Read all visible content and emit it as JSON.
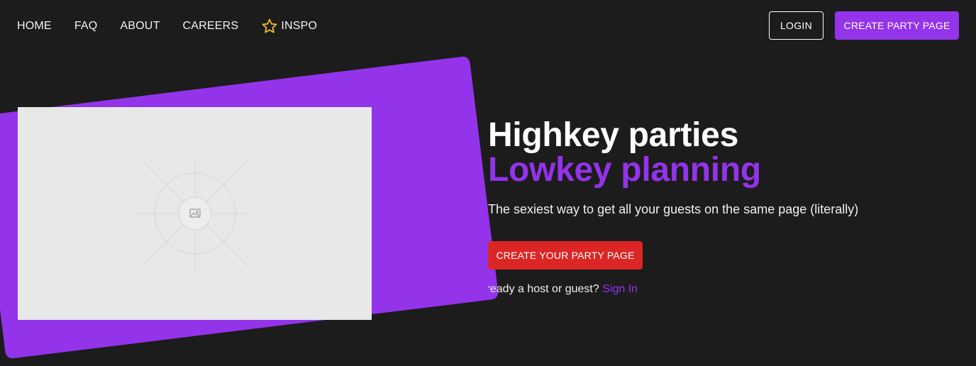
{
  "nav": {
    "links": [
      {
        "label": "HOME"
      },
      {
        "label": "FAQ"
      },
      {
        "label": "ABOUT"
      },
      {
        "label": "CAREERS"
      },
      {
        "label": "INSPO",
        "icon": "star-icon"
      }
    ],
    "login_label": "LOGIN",
    "create_label": "CREATE PARTY PAGE"
  },
  "hero": {
    "title_line1": "Highkey parties",
    "title_line2": "Lowkey planning",
    "subtitle": "The sexiest way to get all your guests on the same page (literally)",
    "cta_label": "CREATE YOUR PARTY PAGE",
    "signin_prompt": "lready a host or guest?",
    "signin_link": "Sign In",
    "image_icon": "image-placeholder-icon"
  },
  "colors": {
    "background": "#1c1c1c",
    "accent_purple": "#9333ea",
    "cta_red": "#dc2626",
    "star_yellow": "#f5b82e",
    "placeholder_gray": "#e8e8e8"
  }
}
